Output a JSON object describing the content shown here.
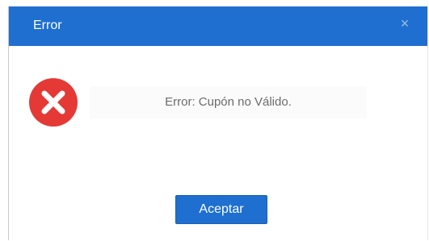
{
  "dialog": {
    "title": "Error",
    "close_icon": "close-icon",
    "message": "Error:  Cupón no Válido.",
    "icon": "error-icon",
    "button_label": "Aceptar"
  },
  "colors": {
    "titlebar": "#1e6fd0",
    "button": "#1e6fd0",
    "error_red": "#e53935"
  }
}
